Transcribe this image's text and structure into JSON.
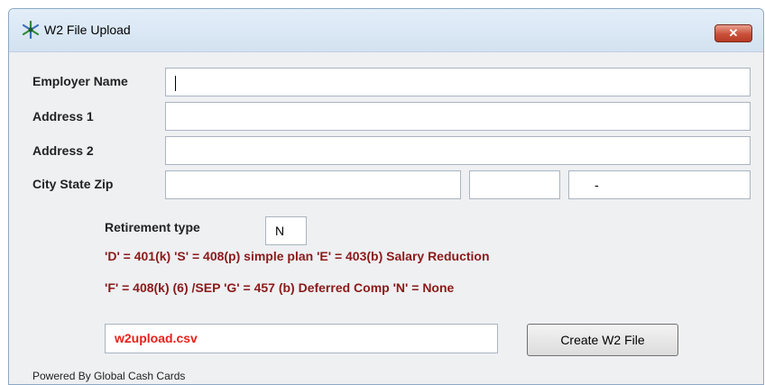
{
  "window": {
    "title": "W2 File Upload",
    "close_label": "✕",
    "icon": "star-icon"
  },
  "form": {
    "employer_name_label": "Employer Name",
    "employer_name_value": "",
    "address1_label": "Address 1",
    "address1_value": "",
    "address2_label": "Address 2",
    "address2_value": "",
    "city_state_zip_label": "City State Zip",
    "city_value": "",
    "state_value": "",
    "zip_value": "-",
    "retirement_type_label": "Retirement type",
    "retirement_type_value": "N",
    "retirement_help_line1": "'D' = 401(k) 'S' = 408(p) simple plan 'E' = 403(b) Salary Reduction",
    "retirement_help_line2": "'F' = 408(k) (6) /SEP 'G' = 457 (b) Deferred Comp 'N' = None",
    "filename_value": "w2upload.csv",
    "create_button_label": "Create W2 File"
  },
  "footer": {
    "text": "Powered By Global Cash Cards"
  },
  "colors": {
    "help_text": "#8b1a1a",
    "filename_text": "#e8201a",
    "close_button": "#c9503a"
  }
}
